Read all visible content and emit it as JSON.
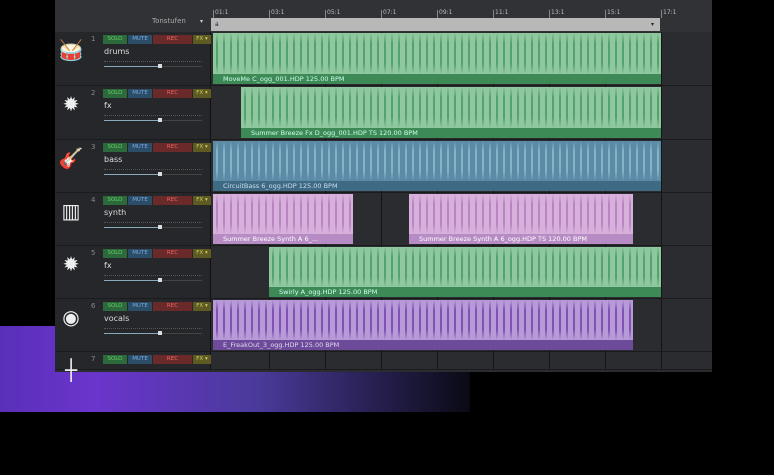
{
  "header": {
    "tonstufen_label": "Tonstufen",
    "dropdown_arrow": "▾",
    "range_start": "a",
    "range_end": "▾"
  },
  "ruler": [
    "01:1",
    "03:1",
    "05:1",
    "07:1",
    "09:1",
    "11:1",
    "13:1",
    "15:1",
    "17:1"
  ],
  "buttons": {
    "solo": "SOLO",
    "mute": "MUTE",
    "rec": "REC",
    "fx": "FX ▾"
  },
  "tracks": [
    {
      "number": "1",
      "name": "drums",
      "icon": "drum-icon",
      "volume": 0.55,
      "clips": [
        {
          "label": "MoveMe C_ogg_001.HDP  125.00 BPM",
          "start": 1,
          "end": 17
        }
      ]
    },
    {
      "number": "2",
      "name": "fx",
      "icon": "explosion-icon",
      "volume": 0.55,
      "clips": [
        {
          "label": "Summer Breeze Fx D_ogg_001.HDP  TS  120.00 BPM",
          "start": 2,
          "end": 17
        }
      ]
    },
    {
      "number": "3",
      "name": "bass",
      "icon": "guitar-icon",
      "volume": 0.55,
      "clips": [
        {
          "label": "CircuitBass 6_ogg.HDP  125.00 BPM",
          "start": 1,
          "end": 17
        }
      ]
    },
    {
      "number": "4",
      "name": "synth",
      "icon": "keyboard-icon",
      "volume": 0.55,
      "clips": [
        {
          "label": "Summer Breeze Synth A 6_...",
          "start": 1,
          "end": 6
        },
        {
          "label": "Summer Breeze Synth A 6_ogg.HDP  TS  120.00 BPM",
          "start": 8,
          "end": 16
        }
      ]
    },
    {
      "number": "5",
      "name": "fx",
      "icon": "explosion-icon",
      "volume": 0.55,
      "clips": [
        {
          "label": "Swirly A_ogg.HDP  125.00 BPM",
          "start": 3,
          "end": 17
        }
      ]
    },
    {
      "number": "6",
      "name": "vocals",
      "icon": "mouth-icon",
      "volume": 0.55,
      "clips": [
        {
          "label": "E_FreakOut_3_ogg.HDP  125.00 BPM",
          "start": 1,
          "end": 16
        }
      ]
    },
    {
      "number": "7",
      "name": "",
      "icon": "empty-icon",
      "volume": 0,
      "clips": []
    }
  ],
  "colors": {
    "green": "#8fc89e",
    "blue": "#5b8ba6",
    "pink": "#d8b0dc",
    "purple": "#b89ad8"
  }
}
